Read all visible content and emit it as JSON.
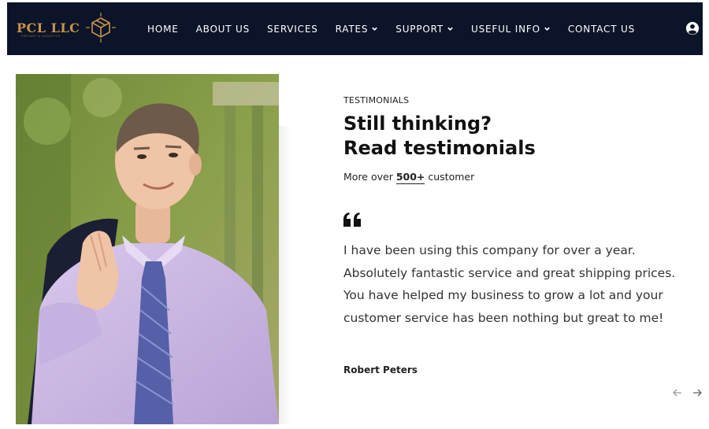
{
  "logo": {
    "name": "PCL LLC",
    "tagline": "FREIGHT & LOGISTICS"
  },
  "colors": {
    "nav_bg": "#0b1428",
    "logo_gold": "#c8944a",
    "text": "#1a1a1a"
  },
  "nav": {
    "items": [
      {
        "label": "HOME",
        "dropdown": false
      },
      {
        "label": "ABOUT US",
        "dropdown": false
      },
      {
        "label": "SERVICES",
        "dropdown": false
      },
      {
        "label": "RATES",
        "dropdown": true
      },
      {
        "label": "SUPPORT",
        "dropdown": true
      },
      {
        "label": "USEFUL INFO",
        "dropdown": true
      },
      {
        "label": "CONTACT US",
        "dropdown": false
      }
    ],
    "account_icon": "user-circle-icon"
  },
  "testimonials": {
    "eyebrow": "TESTIMONIALS",
    "heading_line1": "Still thinking?",
    "heading_line2": "Read testimonials",
    "sub_prefix": "More over ",
    "sub_count": "500+",
    "sub_suffix": " customer",
    "quote_icon": "quote-icon",
    "quote": "I have been using this company for over a year. Absolutely fantastic service and great shipping prices. You have helped my business to grow a lot and your customer service has been nothing but great to me!",
    "author": "Robert Peters",
    "prev_icon": "arrow-left-icon",
    "next_icon": "arrow-right-icon"
  }
}
